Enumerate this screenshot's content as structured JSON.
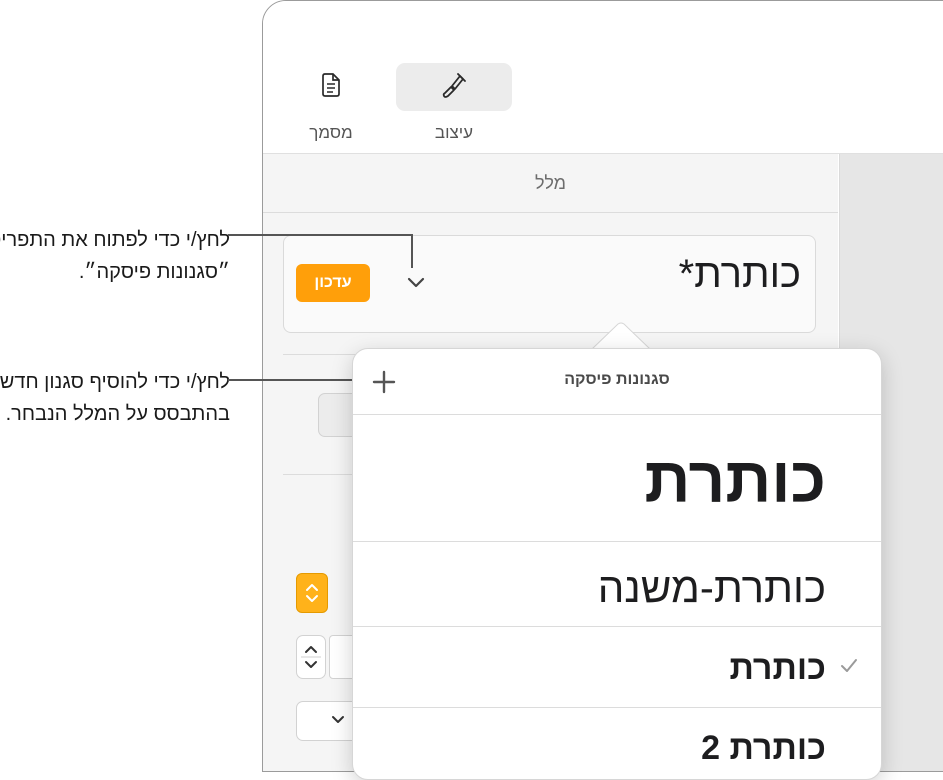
{
  "callouts": {
    "open_menu": "לחץ/י כדי לפתוח את התפריט ״סגנונות פיסקה״.",
    "add_style": "לחץ/י כדי להוסיף סגנון חדש בהתבסס על המלל הנבחר."
  },
  "toolbar": {
    "format_label": "עיצוב",
    "document_label": "מסמך"
  },
  "sidebar": {
    "tab_label": "מלל",
    "current_style": "כותרת*",
    "update_button": "עדכון"
  },
  "popover": {
    "title": "סגנונות פיסקה",
    "styles": [
      {
        "label": "כותרת",
        "checked": false
      },
      {
        "label": "כותרת-משנה",
        "checked": false
      },
      {
        "label": "כותרת",
        "checked": true
      },
      {
        "label": "כותרת 2",
        "checked": false
      }
    ]
  },
  "colors": {
    "accent_orange": "#ff9f0a",
    "leader_line": "#555555"
  },
  "icons": {
    "format": "paintbrush-icon",
    "document": "document-icon",
    "chevron": "chevron-down-icon",
    "add": "plus-icon",
    "check": "checkmark-icon"
  }
}
